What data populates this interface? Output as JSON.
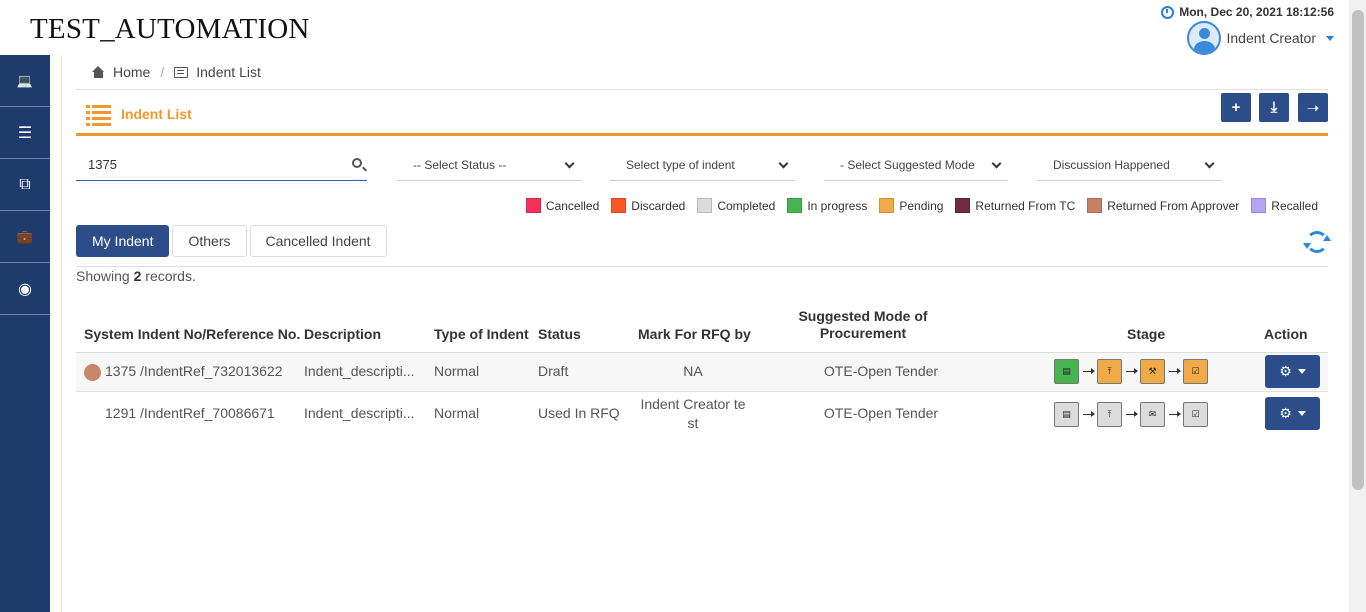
{
  "app": {
    "brand": "TEST_AUTOMATION"
  },
  "header": {
    "datetime": "Mon, Dec 20, 2021 18:12:56",
    "user_name": "Indent Creator"
  },
  "sidebar": {
    "items": [
      {
        "icon": "laptop-icon",
        "glyph": "💻"
      },
      {
        "icon": "indent-icon",
        "glyph": "☰"
      },
      {
        "icon": "copy-icon",
        "glyph": "⧉"
      },
      {
        "icon": "briefcase-icon",
        "glyph": "💼"
      },
      {
        "icon": "weibo-icon",
        "glyph": "◉"
      }
    ]
  },
  "breadcrumb": {
    "home": "Home",
    "separator": "/",
    "current": "Indent List"
  },
  "page": {
    "title": "Indent List"
  },
  "toolbar": {
    "add": "+",
    "download": "⤓",
    "upload": "➝"
  },
  "filters": {
    "search_value": "1375",
    "status": "-- Select Status --",
    "indent_type": "Select type of indent",
    "suggested_mode": "- Select Suggested Mode of",
    "discussion": "Discussion Happened"
  },
  "legend": [
    {
      "label": "Cancelled",
      "color": "#f5325a"
    },
    {
      "label": "Discarded",
      "color": "#fb5625"
    },
    {
      "label": "Completed",
      "color": "#dcdcdc"
    },
    {
      "label": "In progress",
      "color": "#47b450"
    },
    {
      "label": "Pending",
      "color": "#f0ab48"
    },
    {
      "label": "Returned From TC",
      "color": "#6b2d3f"
    },
    {
      "label": "Returned From Approver",
      "color": "#c77f68"
    },
    {
      "label": "Recalled",
      "color": "#b4a4f5"
    }
  ],
  "tabs": {
    "my_indent": "My Indent",
    "others": "Others",
    "cancelled": "Cancelled Indent"
  },
  "records": {
    "prefix": "Showing",
    "count": "2",
    "suffix": "records."
  },
  "table": {
    "headers": {
      "indent_no": "System Indent No/Reference No.",
      "description": "Description",
      "type": "Type of Indent",
      "status": "Status",
      "rfq": "Mark For RFQ by",
      "mode_line1": "Suggested Mode of",
      "mode_line2": "Procurement",
      "stage": "Stage",
      "action": "Action"
    },
    "rows": [
      {
        "indent_no": "1375 /IndentRef_732013622",
        "description": "Indent_descripti...",
        "type": "Normal",
        "status": "Draft",
        "rfq": "NA",
        "rfq_line2": "",
        "mode": "OTE-Open Tender",
        "status_color": "#c5876a"
      },
      {
        "indent_no": "1291 /IndentRef_70086671",
        "description": "Indent_descripti...",
        "type": "Normal",
        "status": "Used In RFQ",
        "rfq": "Indent Creator te",
        "rfq_line2": "st",
        "mode": "OTE-Open Tender",
        "status_color": ""
      }
    ],
    "stage_colors_row1": [
      "#47b450",
      "#f0ab48",
      "#f0ab48",
      "#f0ab48"
    ],
    "stage_colors_row2": [
      "#dcdcdc",
      "#dcdcdc",
      "#dcdcdc",
      "#dcdcdc"
    ],
    "stage_icons": [
      "document-icon",
      "upload-icon",
      "hammer-icon",
      "checkbox-icon"
    ],
    "stage_icons_row2": [
      "document-icon",
      "upload-icon",
      "envelope-icon",
      "checkbox-icon"
    ],
    "action_glyph": "⚙"
  }
}
